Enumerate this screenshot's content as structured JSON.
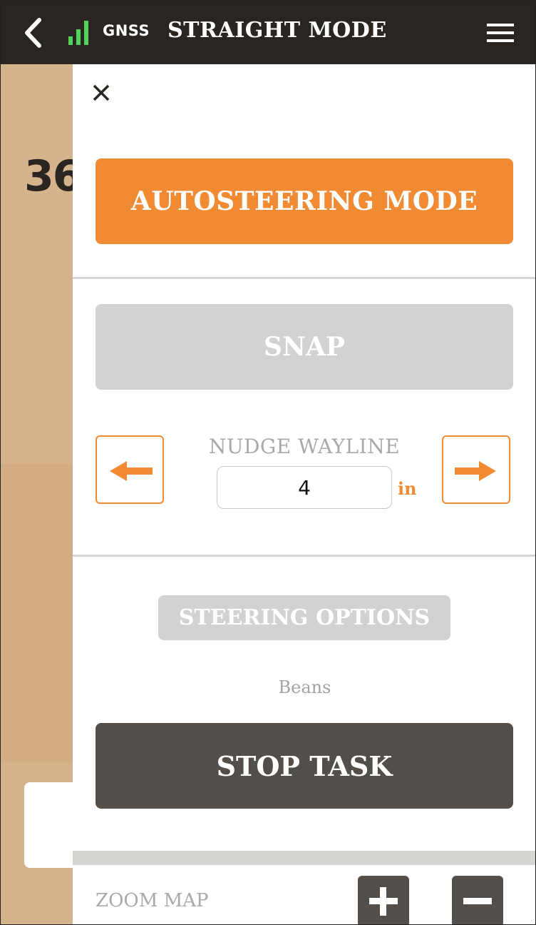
{
  "header": {
    "signal_label": "GNSS",
    "title": "STRAIGHT MODE",
    "back_icon": "chevron-left-icon",
    "menu_icon": "hamburger-menu-icon"
  },
  "map": {
    "row_number": "36"
  },
  "panel": {
    "close_icon": "close-icon",
    "autosteer_label": "AUTOSTEERING MODE",
    "snap_label": "SNAP",
    "nudge": {
      "label": "NUDGE WAYLINE",
      "value": "4",
      "unit": "in",
      "left_icon": "arrow-left-icon",
      "right_icon": "arrow-right-icon"
    },
    "steering_options_label": "STEERING OPTIONS",
    "crop": "Beans",
    "stop_label": "STOP TASK",
    "zoom": {
      "label": "ZOOM MAP",
      "in_icon": "plus-icon",
      "out_icon": "minus-icon"
    }
  },
  "colors": {
    "accent": "#f08a33",
    "header_bg": "#2a2521",
    "signal": "#53d35a",
    "dark_button": "#534e4a",
    "disabled_button": "#d3d2d0",
    "map": "#d5b48d"
  }
}
